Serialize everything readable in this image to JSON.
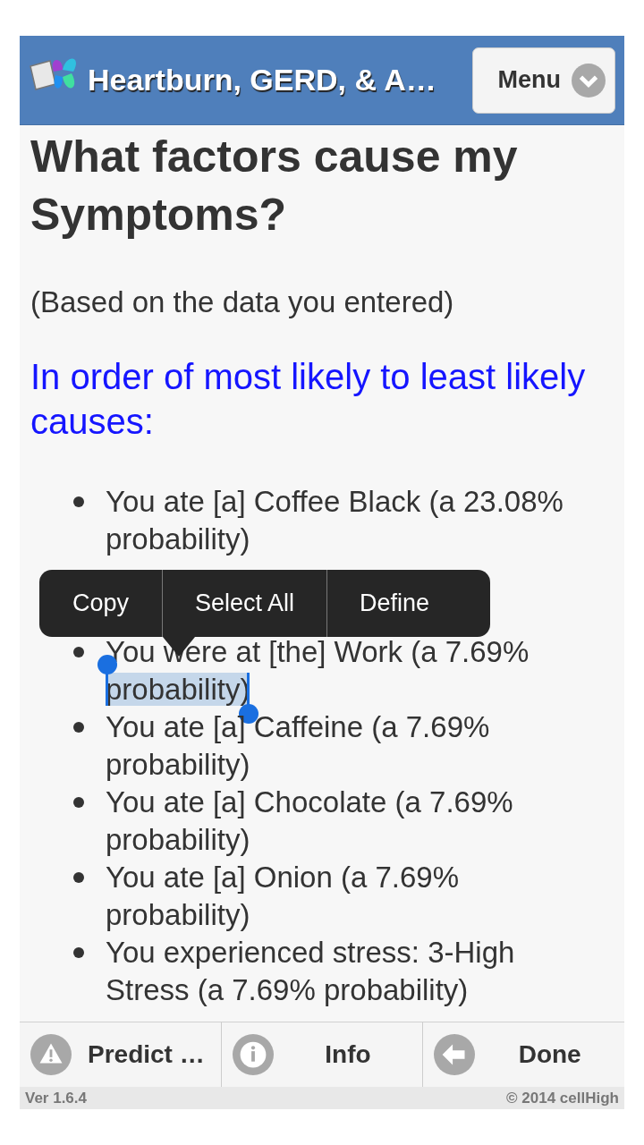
{
  "header": {
    "title": "Heartburn, GERD, & A…",
    "menu_button": "Menu"
  },
  "heading": "What factors cause my Symptoms?",
  "note": "(Based on the data you entered)",
  "subheading": "In order of most likely to least likely causes:",
  "causes": [
    {
      "text": "You ate [a] Coffee Black (a 23.08% probability)"
    },
    {
      "text": "You were at [the] Work (a 7.69% ",
      "selected_text": "probability)"
    },
    {
      "text": "You ate [a] Caffeine (a 7.69% probability)"
    },
    {
      "text": "You ate [a] Chocolate (a 7.69% probability)"
    },
    {
      "text": "You ate [a] Onion (a 7.69% probability)"
    },
    {
      "text": "You experienced stress: 3-High Stress (a 7.69% probability)"
    }
  ],
  "context_menu": [
    "Copy",
    "Select All",
    "Define"
  ],
  "toolbar": [
    {
      "kind": "warning",
      "label": "Predict …"
    },
    {
      "kind": "info",
      "label": "Info"
    },
    {
      "kind": "back",
      "label": "Done"
    }
  ],
  "footer": {
    "version": "Ver 1.6.4",
    "copyright": "© 2014 cellHigh"
  }
}
